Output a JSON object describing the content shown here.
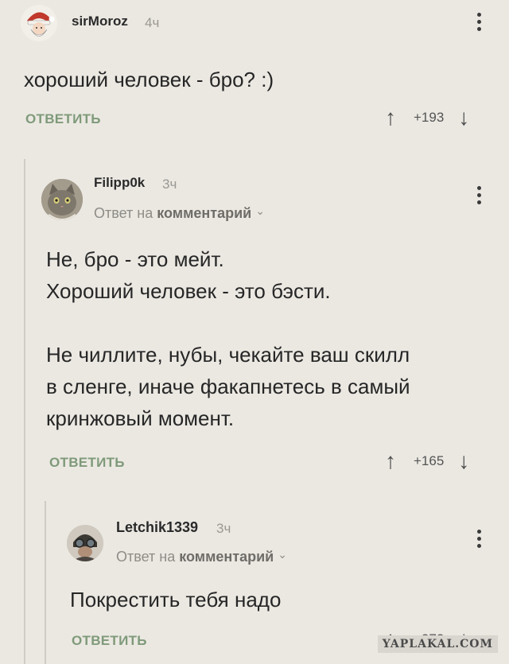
{
  "comments": [
    {
      "author": "sirMoroz",
      "time": "4ч",
      "text": "хороший человек - бро? :)",
      "reply_label": "ОТВЕТИТЬ",
      "score": "+193",
      "avatar_icon": "santa-avatar"
    },
    {
      "author": "Filipp0k",
      "time": "3ч",
      "reply_prefix": "Ответ на",
      "reply_target": "комментарий",
      "text": "Не, бро - это мейт.\nХороший человек - это бэсти.\n\nНе чиллите, нубы, чекайте ваш скилл\nв сленге, иначе факапнетесь в самый\nкринжовый момент.",
      "reply_label": "ОТВЕТИТЬ",
      "score": "+165",
      "avatar_icon": "cat-avatar"
    },
    {
      "author": "Letchik1339",
      "time": "3ч",
      "reply_prefix": "Ответ на",
      "reply_target": "комментарий",
      "text": "Покрестить тебя надо",
      "reply_label": "ОТВЕТИТЬ",
      "score": "+272",
      "avatar_icon": "pilot-avatar"
    }
  ],
  "arrows": {
    "up": "↑",
    "down": "↓",
    "chevron": "⌄"
  },
  "watermark": "YAPLAKAL.COM",
  "colors": {
    "background": "#ebe8e2",
    "reply_button": "#7f9a7a"
  }
}
